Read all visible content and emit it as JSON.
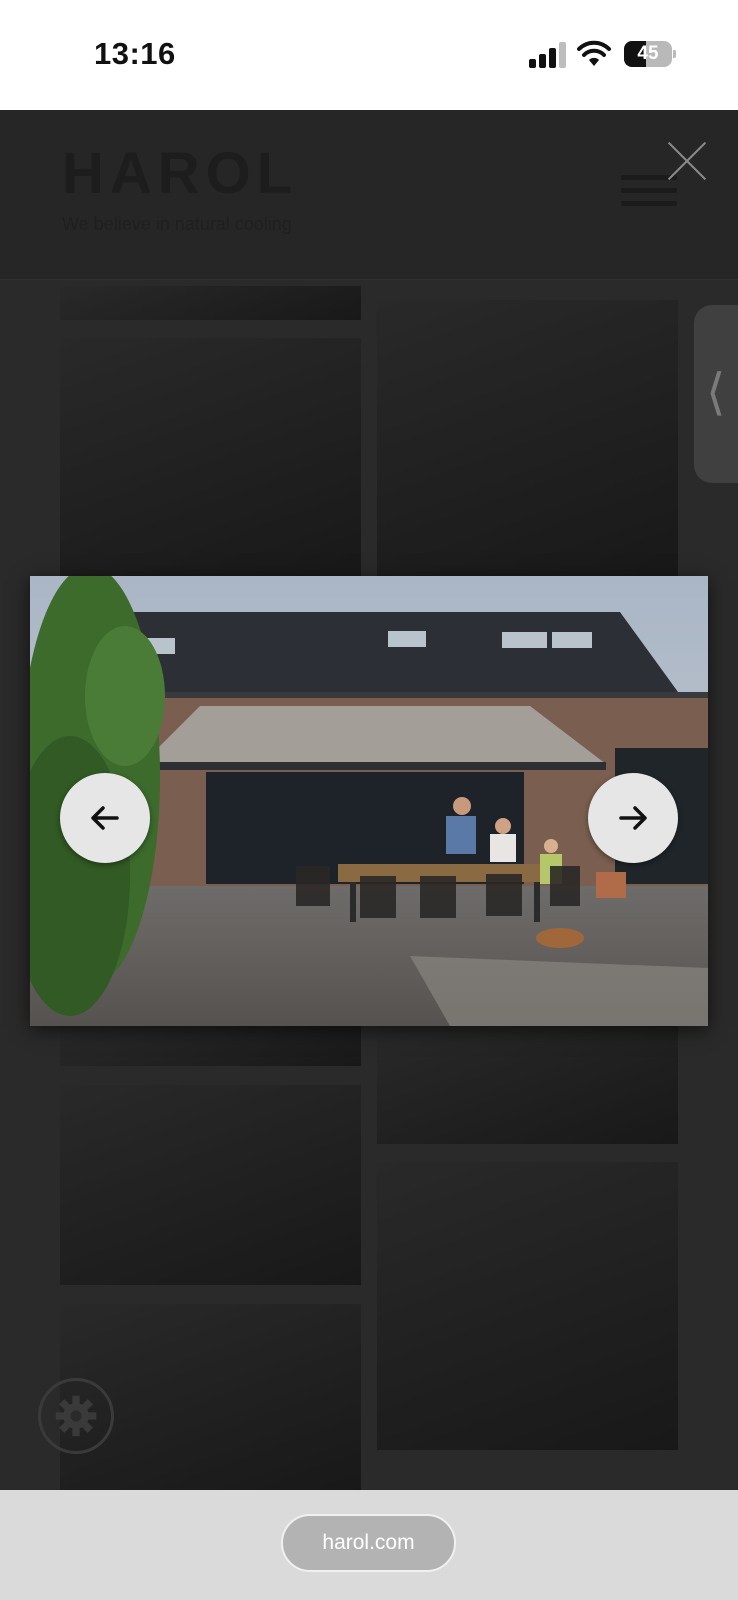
{
  "status_bar": {
    "time": "13:16",
    "battery_level": "45",
    "battery_fraction": 0.45
  },
  "site": {
    "logo": "HAROL",
    "tagline": "We believe in natural cooling"
  },
  "lightbox": {
    "prev_icon": "arrow-left-icon",
    "next_icon": "arrow-right-icon",
    "close_icon": "close-icon"
  },
  "browser": {
    "url": "harol.com"
  },
  "colors": {
    "overlay": "#2a2a2a",
    "nav_button": "#e6e6e6",
    "browser_bar": "#dadada"
  }
}
